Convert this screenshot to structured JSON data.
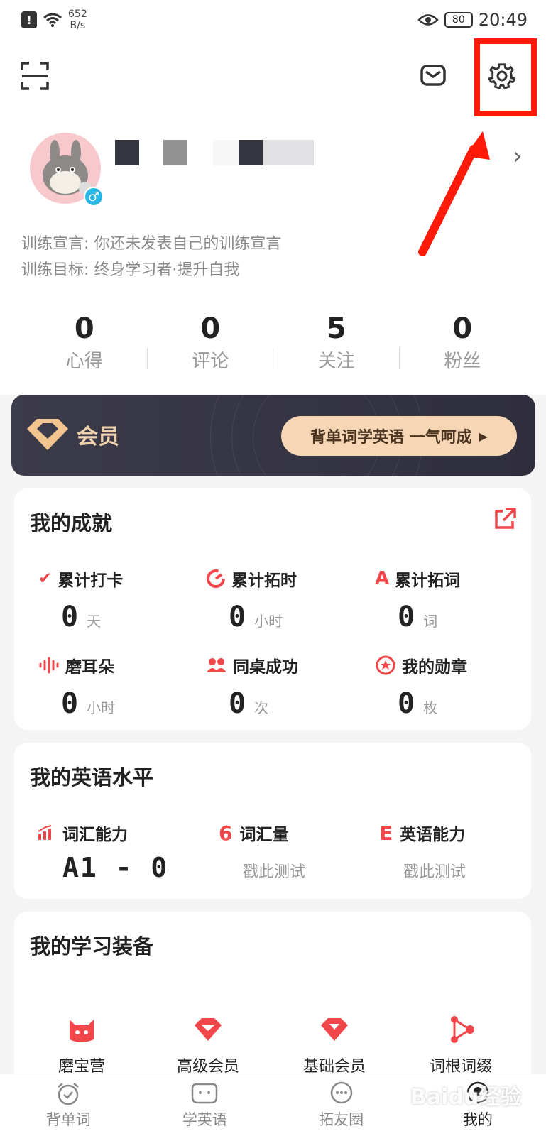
{
  "status_bar": {
    "network_speed_value": "652",
    "network_speed_unit": "B/s",
    "battery": "80",
    "time": "20:49"
  },
  "profile": {
    "declaration_label": "训练宣言:",
    "declaration_value": "你还未发表自己的训练宣言",
    "goal_label": "训练目标:",
    "goal_value": "终身学习者·提升自我",
    "gender_symbol": "♂"
  },
  "stats": [
    {
      "value": "0",
      "label": "心得"
    },
    {
      "value": "0",
      "label": "评论"
    },
    {
      "value": "5",
      "label": "关注"
    },
    {
      "value": "0",
      "label": "粉丝"
    }
  ],
  "vip": {
    "label": "会员",
    "cta": "背单词学英语 一气呵成"
  },
  "achievements": {
    "title": "我的成就",
    "items": [
      {
        "label": "累计打卡",
        "value": "0",
        "unit": "天",
        "icon": "check-icon"
      },
      {
        "label": "累计拓时",
        "value": "0",
        "unit": "小时",
        "icon": "clock-icon"
      },
      {
        "label": "累计拓词",
        "value": "0",
        "unit": "词",
        "icon": "letter-a-icon"
      },
      {
        "label": "磨耳朵",
        "value": "0",
        "unit": "小时",
        "icon": "sound-wave-icon"
      },
      {
        "label": "同桌成功",
        "value": "0",
        "unit": "次",
        "icon": "partners-icon"
      },
      {
        "label": "我的勋章",
        "value": "0",
        "unit": "枚",
        "icon": "medal-icon"
      }
    ]
  },
  "english_level": {
    "title": "我的英语水平",
    "items": [
      {
        "label": "词汇能力",
        "value": "A1 - 0",
        "icon": "bar-chart-icon"
      },
      {
        "label": "词汇量",
        "value": "戳此测试",
        "icon": "number-six-icon"
      },
      {
        "label": "英语能力",
        "value": "戳此测试",
        "icon": "letter-e-icon"
      }
    ]
  },
  "equipment": {
    "title": "我的学习装备",
    "items": [
      {
        "label": "磨宝营",
        "icon": "monster-icon"
      },
      {
        "label": "高级会员",
        "icon": "vip-gem-icon"
      },
      {
        "label": "基础会员",
        "icon": "basic-gem-icon"
      },
      {
        "label": "词根词缀",
        "icon": "network-icon"
      }
    ]
  },
  "tabs": [
    {
      "label": "背单词",
      "icon": "alarm-clock-icon",
      "active": false
    },
    {
      "label": "学英语",
      "icon": "mascot-icon",
      "active": false
    },
    {
      "label": "拓友圈",
      "icon": "chat-bubble-icon",
      "active": false
    },
    {
      "label": "我的",
      "icon": "profile-icon",
      "active": true
    }
  ],
  "watermark": "Baidu经验",
  "colors": {
    "accent": "#f2474a",
    "vip_bg": "#3c3b4a",
    "vip_gold": "#f6d6b5",
    "highlight": "#ff1a0a"
  }
}
